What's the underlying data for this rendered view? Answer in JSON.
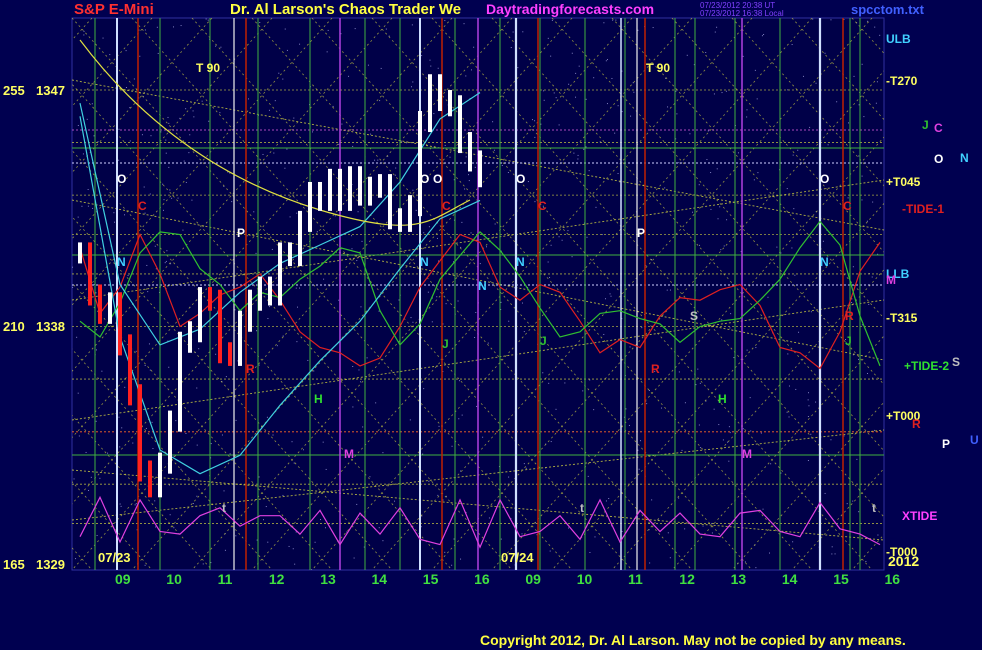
{
  "header": {
    "instrument": "S&P E-Mini",
    "title": "Dr. Al Larson's Chaos Trader We",
    "website": "Daytradingforecasts.com",
    "timestamp_1": "07/23/2012 20:38 UT",
    "timestamp_2": "07/23/2012 16:38 Local",
    "filename": "spcctom.txt"
  },
  "footer": {
    "copyright": "Copyright 2012, Dr. Al Larson. May not be copied by any means."
  },
  "colors": {
    "background": "#000050",
    "grid_green": "#40b040",
    "grid_yellow": "#d0d040",
    "vertical_white": "#d0e0ff",
    "vertical_red": "#c02000",
    "vertical_purple": "#b040e0",
    "price_bars": "#ffffff",
    "price_bars_down": "#ff2020",
    "tide1": "#e02020",
    "tide2": "#30c030",
    "xtide": "#e040e0",
    "cyan_curve": "#40d0e0"
  },
  "chart_data": {
    "type": "line",
    "title": "S&P E-Mini",
    "y_axis_left": [
      {
        "degree": "255",
        "price": "1347"
      },
      {
        "degree": "210",
        "price": "1338"
      },
      {
        "degree": "165",
        "price": "1329"
      }
    ],
    "ylim": [
      1329,
      1347
    ],
    "x_hour_ticks": [
      "09",
      "10",
      "11",
      "12",
      "13",
      "14",
      "15",
      "16",
      "09",
      "10",
      "11",
      "12",
      "13",
      "14",
      "15",
      "16"
    ],
    "date_labels": [
      "07/23",
      "07/24"
    ],
    "year_label": "2012",
    "right_labels": [
      {
        "text": "ULB",
        "color": "#40d0ff"
      },
      {
        "text": "-T270",
        "color": "#ffff60"
      },
      {
        "text": "+T045",
        "color": "#ffff60"
      },
      {
        "text": "-TIDE-1",
        "color": "#e02020"
      },
      {
        "text": "LLB",
        "color": "#40d0ff"
      },
      {
        "text": "-T315",
        "color": "#ffff60"
      },
      {
        "text": "+TIDE-2",
        "color": "#30e030"
      },
      {
        "text": "+T000",
        "color": "#ffff60"
      },
      {
        "text": "XTIDE",
        "color": "#ff40ff"
      },
      {
        "text": "-T000",
        "color": "#ffff60"
      }
    ],
    "planet_labels": [
      "J",
      "C",
      "O",
      "N",
      "M",
      "S",
      "R",
      "P",
      "U"
    ],
    "in_chart_markers": [
      "T  90",
      "T  90",
      "O",
      "O",
      "O",
      "O",
      "O",
      "C",
      "C",
      "C",
      "C",
      "N",
      "N",
      "N",
      "N",
      "N",
      "P",
      "P",
      "R",
      "R",
      "R",
      "J",
      "J",
      "J",
      "H",
      "H",
      "M",
      "M",
      "S",
      "t",
      "t",
      "t"
    ],
    "series": [
      {
        "name": "S&P E-Mini price (close)",
        "x": [
          0,
          2,
          4,
          6,
          8,
          10,
          12,
          14,
          16,
          18,
          20,
          22,
          24,
          26,
          28,
          30,
          32,
          34,
          36,
          38,
          40,
          42,
          44,
          46,
          48,
          50,
          52,
          54,
          56,
          58,
          60,
          62,
          64,
          66,
          68,
          70,
          72,
          74,
          76,
          78,
          80
        ],
        "values": [
          1340.8,
          1339.2,
          1338.5,
          1338.9,
          1337.3,
          1335.4,
          1332.5,
          1331.9,
          1332.8,
          1334.4,
          1337.4,
          1337.8,
          1339.1,
          1339.0,
          1337.0,
          1336.9,
          1338.2,
          1339.0,
          1339.5,
          1339.2,
          1340.8,
          1340.7,
          1342.0,
          1343.1,
          1342.8,
          1343.6,
          1342.8,
          1343.7,
          1343.0,
          1343.3,
          1343.4,
          1342.1,
          1342.0,
          1342.6,
          1345.8,
          1347.2,
          1346.6,
          1346.4,
          1345.0,
          1344.3,
          1343.7
        ]
      },
      {
        "name": "-TIDE-1",
        "x": [
          0,
          4,
          8,
          12,
          16,
          20,
          24,
          28,
          32,
          36,
          40,
          44,
          48,
          52,
          56,
          60,
          64,
          68,
          72,
          76,
          80,
          84,
          88,
          92,
          96,
          100,
          104,
          108,
          112,
          116,
          120,
          124,
          128,
          132,
          136,
          140,
          144,
          148,
          152,
          156,
          160
        ],
        "values": [
          1341.0,
          1338.5,
          1339.5,
          1341.5,
          1340.0,
          1338.0,
          1338.5,
          1339.2,
          1339.5,
          1340.0,
          1339.0,
          1337.8,
          1337.2,
          1337.0,
          1336.5,
          1336.8,
          1338.0,
          1339.5,
          1340.5,
          1341.5,
          1341.2,
          1339.5,
          1339.0,
          1339.6,
          1339.3,
          1338.2,
          1337.0,
          1337.5,
          1337.2,
          1338.4,
          1339.1,
          1339.0,
          1339.4,
          1339.6,
          1338.8,
          1337.2,
          1337.0,
          1336.4,
          1337.8,
          1340.1,
          1341.2
        ]
      },
      {
        "name": "+TIDE-2",
        "x": [
          0,
          4,
          8,
          12,
          16,
          20,
          24,
          28,
          32,
          36,
          40,
          44,
          48,
          52,
          56,
          60,
          64,
          68,
          72,
          76,
          80,
          84,
          88,
          92,
          96,
          100,
          104,
          108,
          112,
          116,
          120,
          124,
          128,
          132,
          136,
          140,
          144,
          148,
          152,
          156,
          160
        ],
        "values": [
          1338.2,
          1337.6,
          1338.9,
          1340.8,
          1341.6,
          1341.5,
          1340.2,
          1339.6,
          1338.6,
          1339.3,
          1339.1,
          1339.8,
          1340.3,
          1341.0,
          1340.8,
          1338.6,
          1337.3,
          1338.1,
          1339.8,
          1340.7,
          1341.6,
          1340.9,
          1339.9,
          1338.7,
          1337.6,
          1337.8,
          1338.5,
          1338.6,
          1338.3,
          1338.1,
          1337.4,
          1338.0,
          1338.2,
          1338.3,
          1339.0,
          1339.8,
          1341.0,
          1342.0,
          1341.1,
          1338.4,
          1336.5
        ]
      },
      {
        "name": "XTIDE",
        "x": [
          0,
          4,
          8,
          12,
          16,
          20,
          24,
          28,
          32,
          36,
          40,
          44,
          48,
          52,
          56,
          60,
          64,
          68,
          72,
          76,
          80,
          84,
          88,
          92,
          96,
          100,
          104,
          108,
          112,
          116,
          120,
          124,
          128,
          132,
          136,
          140,
          144,
          148,
          152,
          156,
          160
        ],
        "values": [
          1330.0,
          1331.5,
          1329.8,
          1331.4,
          1330.2,
          1330.1,
          1330.8,
          1331.1,
          1330.4,
          1330.8,
          1330.8,
          1330.1,
          1331.0,
          1329.7,
          1330.9,
          1330.1,
          1331.1,
          1329.9,
          1329.7,
          1331.4,
          1329.6,
          1331.4,
          1330.0,
          1330.2,
          1330.8,
          1329.9,
          1331.4,
          1329.8,
          1331.0,
          1330.2,
          1330.9,
          1330.1,
          1330.0,
          1330.9,
          1331.0,
          1330.2,
          1330.0,
          1331.3,
          1330.3,
          1330.1,
          1329.7
        ]
      },
      {
        "name": "Lower band (cyan)",
        "x": [
          0,
          8,
          16,
          24,
          32,
          40,
          48,
          56,
          64,
          72,
          80
        ],
        "values": [
          1346.0,
          1337.6,
          1333.3,
          1332.4,
          1333.1,
          1335.0,
          1336.7,
          1338.2,
          1340.2,
          1342.1,
          1342.8
        ]
      },
      {
        "name": "Upper band (cyan)",
        "x": [
          0,
          8,
          16,
          24,
          32,
          40,
          48,
          56,
          64,
          72,
          80
        ],
        "values": [
          1346.5,
          1339.6,
          1337.3,
          1337.9,
          1339.3,
          1340.4,
          1341.1,
          1341.8,
          1343.5,
          1345.9,
          1346.9
        ]
      }
    ],
    "grid": true,
    "legend": "right"
  }
}
